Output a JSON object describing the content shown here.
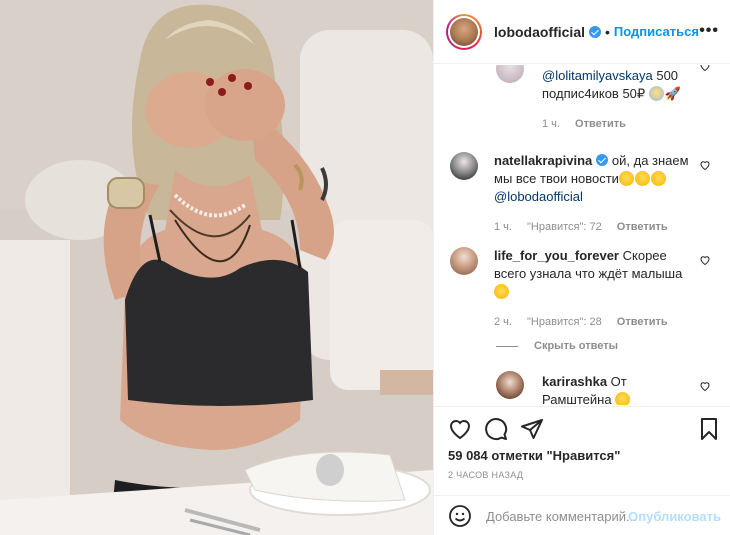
{
  "post": {
    "image_alt": "Photo of a woman covering her eyes with her hands, seated at a table in a private jet"
  },
  "header": {
    "username": "lobodaofficial",
    "separator": "•",
    "follow_label": "Подписаться",
    "more_label": "•••"
  },
  "comments": [
    {
      "username": "",
      "text_mention": "@lolitamilyavskaya",
      "text_rest": " 500 подпис4иков 50₽",
      "time": "1 ч.",
      "likes": "",
      "reply_label": "Ответить"
    },
    {
      "username": "natellakrapivina",
      "text_before": " ой, да знаем мы все твои новости",
      "text_mention": "@lobodaofficial",
      "time": "1 ч.",
      "likes": "\"Нравится\": 72",
      "reply_label": "Ответить"
    },
    {
      "username": "life_for_you_forever",
      "text": " Скорее всего узнала что ждёт малыша",
      "time": "2 ч.",
      "likes": "\"Нравится\": 28",
      "reply_label": "Ответить"
    },
    {
      "username": "karirashka",
      "text": " От Рамштейна"
    }
  ],
  "hide_replies_label": "Скрыть ответы",
  "actions": {
    "likes_count": "59 084 отметки \"Нравится\"",
    "time_ago": "2 часов назад"
  },
  "add_comment": {
    "placeholder": "Добавьте комментарий...",
    "publish_label": "Опубликовать"
  },
  "colors": {
    "accent": "#0095f6",
    "publish_disabled": "#b2dffc",
    "muted": "#8e8e8e"
  }
}
